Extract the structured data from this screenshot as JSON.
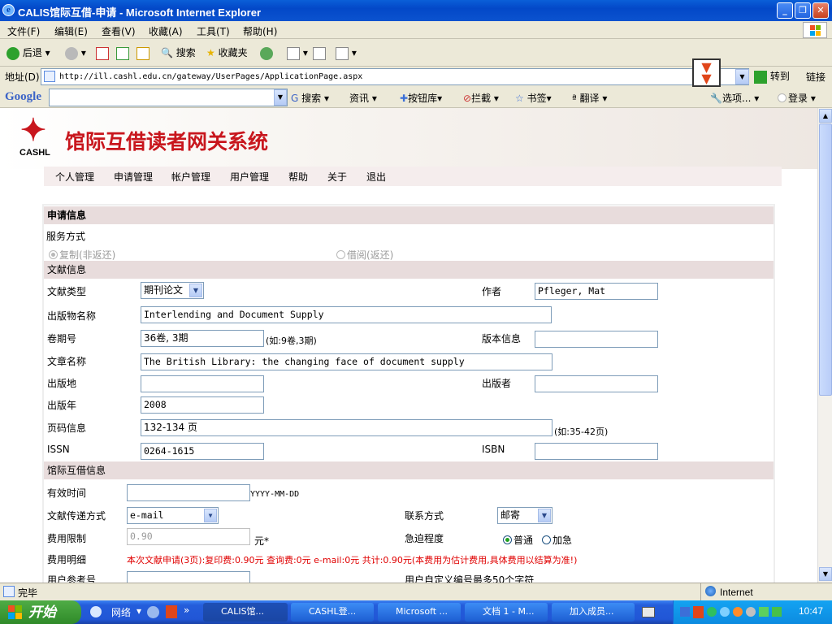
{
  "window": {
    "title": "CALIS馆际互借-申请 - Microsoft Internet Explorer"
  },
  "menu": [
    "文件(F)",
    "编辑(E)",
    "查看(V)",
    "收藏(A)",
    "工具(T)",
    "帮助(H)"
  ],
  "toolbar": {
    "back": "后退",
    "search": "搜索",
    "favorites": "收藏夹"
  },
  "address": {
    "label": "地址(D)",
    "url": "http://ill.cashl.edu.cn/gateway/UserPages/ApplicationPage.aspx",
    "go": "转到",
    "links": "链接"
  },
  "google": {
    "logo": "Google",
    "search": "搜索",
    "news": "资讯",
    "buttons": "按钮库",
    "block": "拦截",
    "bookmarks": "书签",
    "translate": "翻译",
    "options": "选项...",
    "login": "登录"
  },
  "site": {
    "logo_text": "CASHL",
    "title": "馆际互借读者网关系统",
    "nav": [
      "个人管理",
      "申请管理",
      "帐户管理",
      "用户管理",
      "帮助",
      "关于",
      "退出"
    ]
  },
  "form": {
    "section_request": "申请信息",
    "service_mode": "服务方式",
    "opt_copy": "复制(非返还)",
    "opt_loan": "借阅(返还)",
    "section_doc": "文献信息",
    "doc_type_label": "文献类型",
    "doc_type_value": "期刊论文",
    "author_label": "作者",
    "author_value": "Pfleger, Mat",
    "pub_name_label": "出版物名称",
    "pub_name_value": "Interlending and Document Supply",
    "volume_label": "卷期号",
    "volume_value": "36卷, 3期",
    "volume_hint": "(如:9卷,3期)",
    "edition_label": "版本信息",
    "edition_value": "",
    "article_label": "文章名称",
    "article_value": "The British Library: the changing face of document supply",
    "place_label": "出版地",
    "place_value": "",
    "publisher_label": "出版者",
    "publisher_value": "",
    "year_label": "出版年",
    "year_value": "2008",
    "pages_label": "页码信息",
    "pages_value": "132-134 页",
    "pages_hint": "(如:35-42页)",
    "issn_label": "ISSN",
    "issn_value": "0264-1615",
    "isbn_label": "ISBN",
    "isbn_value": "",
    "section_ill": "馆际互借信息",
    "valid_label": "有效时间",
    "valid_value": "",
    "valid_hint": "YYYY-MM-DD",
    "delivery_label": "文献传递方式",
    "delivery_value": "e-mail",
    "contact_label": "联系方式",
    "contact_value": "邮寄",
    "fee_limit_label": "费用限制",
    "fee_limit_value": "0.90",
    "fee_unit": "元*",
    "urgency_label": "急迫程度",
    "urgency_normal": "普通",
    "urgency_urgent": "加急",
    "fee_detail_label": "费用明细",
    "fee_detail_text": "本次文献申请(3页):复印费:0.90元  查询费:0元  e-mail:0元   共计:0.90元(本费用为估计费用,具体费用以结算为准!)",
    "ref_label": "用户参考号",
    "custom_hint": "用户自定义编号最多50个字符"
  },
  "status": {
    "left": "完毕",
    "zone": "Internet"
  },
  "taskbar": {
    "start": "开始",
    "network": "网络",
    "tasks": [
      "CALIS馆...",
      "CASHL登...",
      "Microsoft ...",
      "文档 1 - M...",
      "加入成员..."
    ],
    "clock": "10:47"
  }
}
